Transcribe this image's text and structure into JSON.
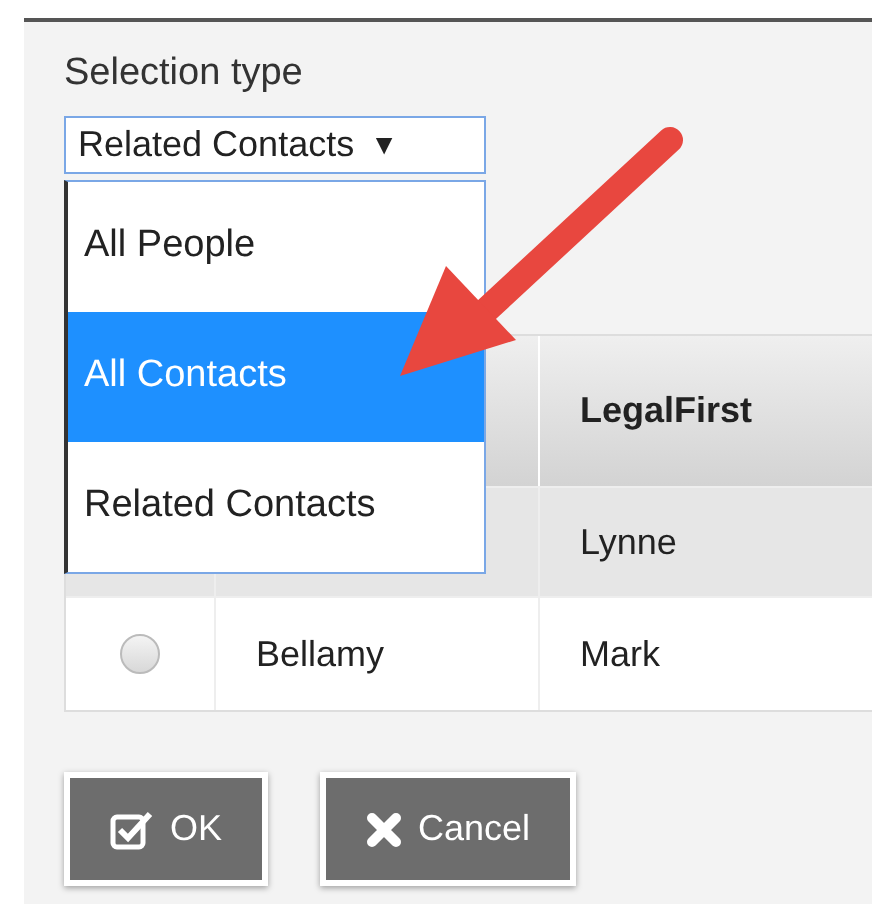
{
  "selection_type": {
    "label": "Selection type",
    "value": "Related Contacts",
    "caret": "▼",
    "expanded": true,
    "options": [
      {
        "label": "All People",
        "highlighted": false
      },
      {
        "label": "All Contacts",
        "highlighted": true
      },
      {
        "label": "Related Contacts",
        "highlighted": false
      }
    ]
  },
  "table": {
    "columns": {
      "column_3": "LegalFirst"
    },
    "rows": [
      {
        "column_3": "Lynne"
      },
      {
        "selected": false,
        "column_2": "Bellamy",
        "column_3": "Mark"
      }
    ]
  },
  "buttons": [
    {
      "kind": "ok",
      "label": "OK"
    },
    {
      "kind": "cancel",
      "label": "Cancel"
    }
  ]
}
